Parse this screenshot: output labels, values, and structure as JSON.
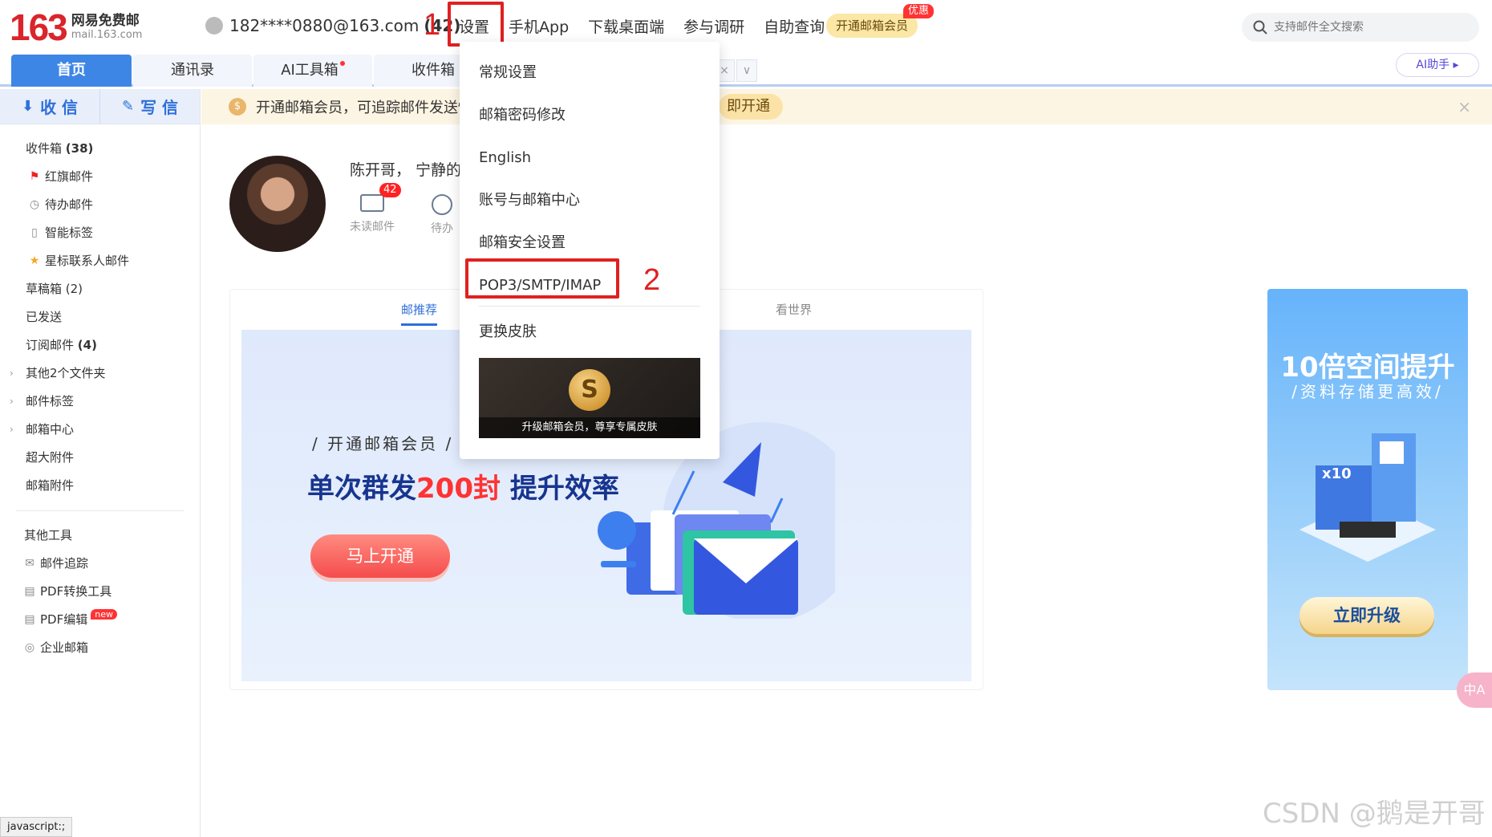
{
  "header": {
    "logo_number": "163",
    "logo_title": "网易免费邮",
    "logo_domain": "mail.163.com",
    "account": "182****0880@163.com",
    "unread_count": "(42)",
    "nav": [
      "设置",
      "手机App",
      "下载桌面端",
      "参与调研",
      "自助查询"
    ],
    "vip_button": "开通邮箱会员",
    "vip_badge": "优惠",
    "search_placeholder": "支持邮件全文搜索"
  },
  "annotations": {
    "step1": "1",
    "step2": "2",
    "color": "#e02020"
  },
  "tabs": [
    "首页",
    "通讯录",
    "AI工具箱",
    "收件箱"
  ],
  "ai_assistant": "AI助手",
  "sidebar": {
    "receive": "收 信",
    "write": "写 信",
    "items": [
      {
        "label": "收件箱",
        "count": "(38)"
      },
      {
        "label": "红旗邮件"
      },
      {
        "label": "待办邮件"
      },
      {
        "label": "智能标签"
      },
      {
        "label": "星标联系人邮件"
      },
      {
        "label": "草稿箱 (2)"
      },
      {
        "label": "已发送"
      },
      {
        "label": "订阅邮件",
        "count": "(4)"
      },
      {
        "label": "其他2个文件夹"
      },
      {
        "label": "邮件标签"
      },
      {
        "label": "邮箱中心"
      },
      {
        "label": "超大附件"
      },
      {
        "label": "邮箱附件"
      }
    ],
    "tools_title": "其他工具",
    "tools": [
      "邮件追踪",
      "PDF转换工具",
      "PDF编辑",
      "企业邮箱"
    ],
    "new_tag": "new"
  },
  "notice": {
    "text": "开通邮箱会员，可追踪邮件发送情",
    "open": "即开通"
  },
  "profile": {
    "greeting": "陈开哥，  宁静的",
    "unread_badge": "42",
    "unread_label": "未读邮件",
    "todo_label": "待办"
  },
  "card": {
    "tab_left": "邮推荐",
    "tab_right": "看世界",
    "kicker": "/ 开通邮箱会员 /",
    "headline_a": "单次群发",
    "headline_red": "200封",
    "headline_b": " 提升效率",
    "cta": "马上开通"
  },
  "side_ad": {
    "title": "10倍空间提升",
    "subtitle": "/资料存储更高效/",
    "badge": "x10",
    "button": "立即升级"
  },
  "dropdown": {
    "items": [
      "常规设置",
      "邮箱密码修改",
      "English",
      "账号与邮箱中心",
      "邮箱安全设置",
      "POP3/SMTP/IMAP",
      "更换皮肤"
    ],
    "skin_caption": "升级邮箱会员，尊享专属皮肤"
  },
  "translate": "中A",
  "status_text": "javascript:;",
  "watermark": "CSDN @鹅是开哥"
}
